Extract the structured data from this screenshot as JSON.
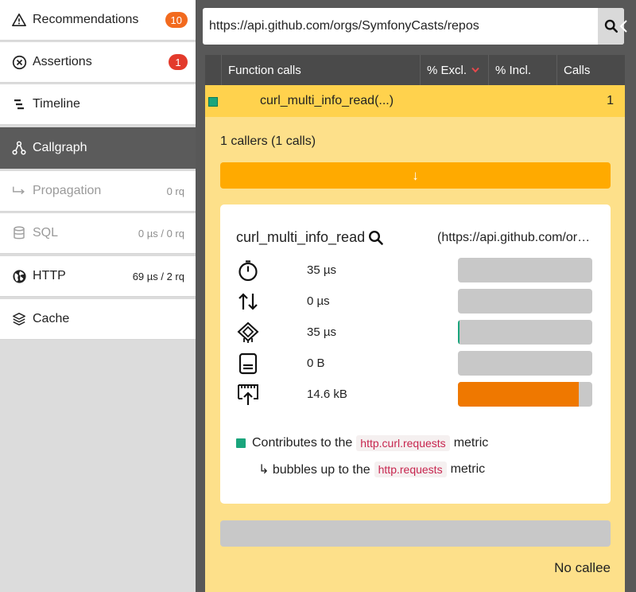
{
  "sidebar": {
    "items": [
      {
        "label": "Recommendations",
        "icon": "warning-icon",
        "badge": "10",
        "badge_color": "#f26a1e"
      },
      {
        "label": "Assertions",
        "icon": "circle-x-icon",
        "badge": "1",
        "badge_color": "#e33a2b"
      },
      {
        "label": "Timeline",
        "icon": "timeline-icon"
      },
      {
        "label": "Callgraph",
        "icon": "callgraph-icon",
        "active": true
      },
      {
        "label": "Propagation",
        "icon": "propagation-arrow-icon",
        "meta": "0 rq",
        "disabled": true
      },
      {
        "label": "SQL",
        "icon": "database-icon",
        "meta": "0 µs / 0 rq",
        "disabled": true
      },
      {
        "label": "HTTP",
        "icon": "globe-icon",
        "meta": "69 µs / 2 rq"
      },
      {
        "label": "Cache",
        "icon": "layers-icon"
      }
    ]
  },
  "search": {
    "value": "https://api.github.com/orgs/SymfonyCasts/repos",
    "icon": "search-icon"
  },
  "table": {
    "columns": [
      "Function calls",
      "% Excl.",
      "% Incl.",
      "Calls"
    ],
    "sorted_column": "% Excl.",
    "row": {
      "function": "curl_multi_info_read(...)",
      "calls": "1",
      "marker_color": "#1aa57c"
    }
  },
  "panel": {
    "callers_label": "1 callers (1 calls)",
    "callers_arrow": "↓",
    "card": {
      "function": "curl_multi_info_read",
      "argument": "(https://api.github.com/orgs/SymfonyCasts/repos)",
      "metrics": [
        {
          "icon": "stopwatch-icon",
          "value": "35 µs",
          "fill": 0.0
        },
        {
          "icon": "io-arrows-icon",
          "value": "0 µs",
          "fill": 0.0
        },
        {
          "icon": "cpu-chip-icon",
          "value": "35 µs",
          "fill": 0.01
        },
        {
          "icon": "memory-icon",
          "value": "0 B",
          "fill": 0.0
        },
        {
          "icon": "network-upload-icon",
          "value": "14.6 kB",
          "fill": 0.9
        }
      ],
      "contributes_prefix": "Contributes to the",
      "contributes_metric": "http.curl.requests",
      "contributes_suffix": "metric",
      "bubbles_prefix": "↳ bubbles up to the",
      "bubbles_metric": "http.requests",
      "bubbles_suffix": "metric"
    },
    "no_callee": "No callee"
  },
  "colors": {
    "accent_orange": "#ffaa00",
    "row_yellow": "#ffd24d",
    "panel_yellow": "#fde08a",
    "metric_bar_fill": "#ef7800",
    "sidebar_active": "#5b5b5b"
  }
}
